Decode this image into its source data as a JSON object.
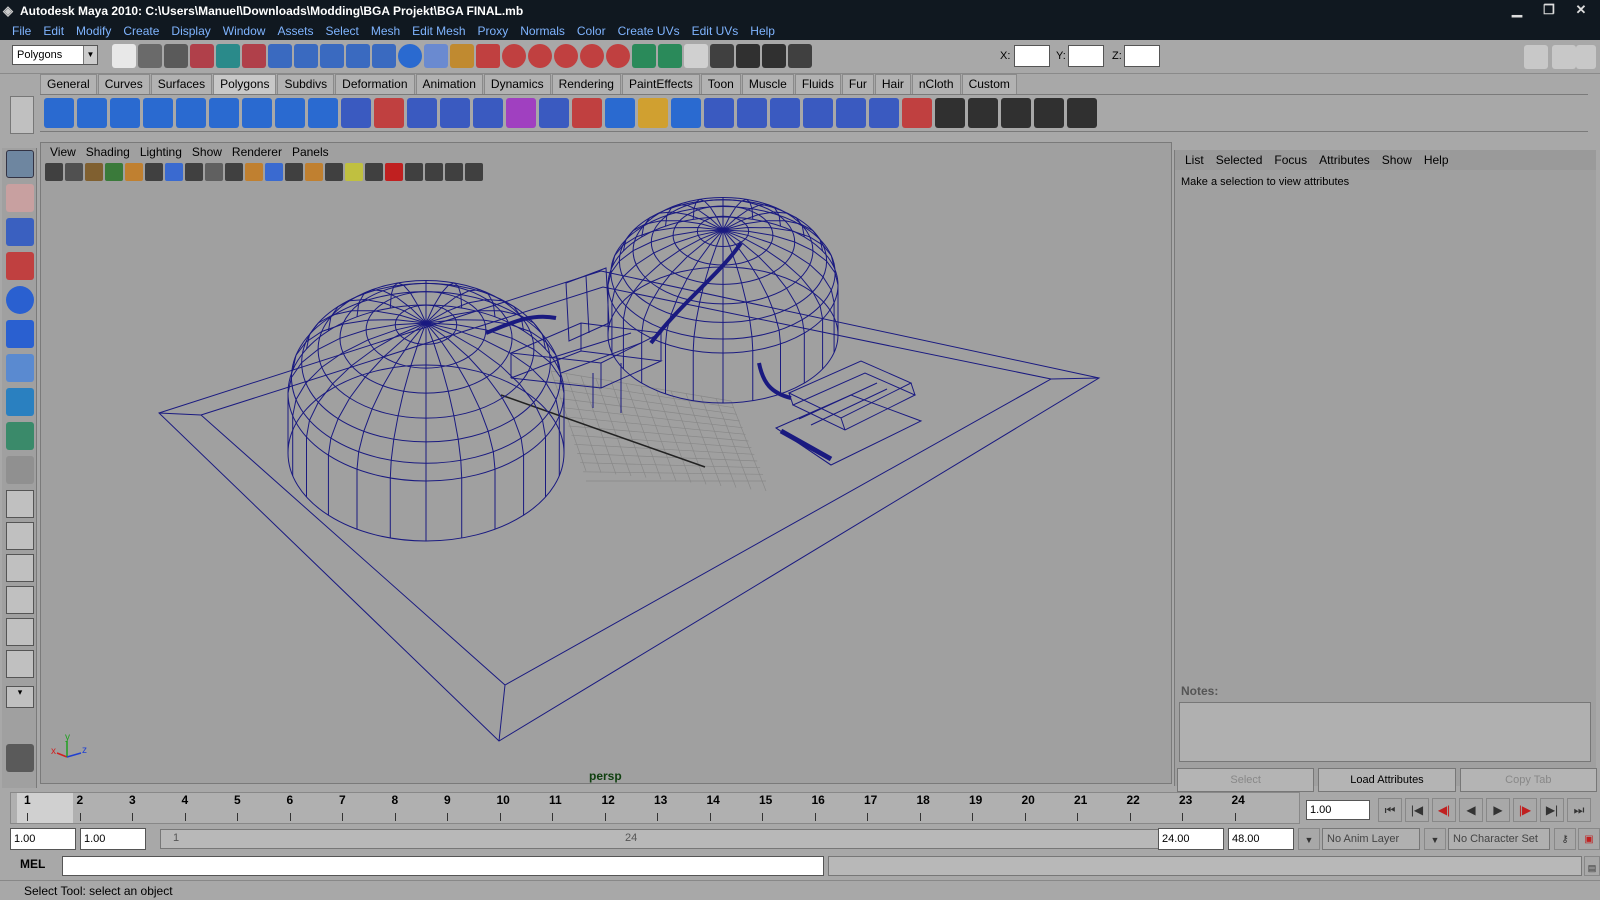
{
  "window": {
    "title": "Autodesk Maya 2010: C:\\Users\\Manuel\\Downloads\\Modding\\BGA Projekt\\BGA FINAL.mb"
  },
  "menubar": [
    "File",
    "Edit",
    "Modify",
    "Create",
    "Display",
    "Window",
    "Assets",
    "Select",
    "Mesh",
    "Edit Mesh",
    "Proxy",
    "Normals",
    "Color",
    "Create UVs",
    "Edit UVs",
    "Help"
  ],
  "status": {
    "mode": "Polygons",
    "x_label": "X:",
    "y_label": "Y:",
    "z_label": "Z:"
  },
  "shelf_tabs": [
    "General",
    "Curves",
    "Surfaces",
    "Polygons",
    "Subdivs",
    "Deformation",
    "Animation",
    "Dynamics",
    "Rendering",
    "PaintEffects",
    "Toon",
    "Muscle",
    "Fluids",
    "Fur",
    "Hair",
    "nCloth",
    "Custom"
  ],
  "shelf_active": "Polygons",
  "viewport": {
    "menu": [
      "View",
      "Shading",
      "Lighting",
      "Show",
      "Renderer",
      "Panels"
    ],
    "camera": "persp"
  },
  "attribute_editor": {
    "menu": [
      "List",
      "Selected",
      "Focus",
      "Attributes",
      "Show",
      "Help"
    ],
    "message": "Make a selection to view attributes",
    "notes_label": "Notes:",
    "buttons": [
      "Select",
      "Load Attributes",
      "Copy Tab"
    ]
  },
  "timeline": {
    "ticks": [
      "1",
      "2",
      "3",
      "4",
      "5",
      "6",
      "7",
      "8",
      "9",
      "10",
      "11",
      "12",
      "13",
      "14",
      "15",
      "16",
      "17",
      "18",
      "19",
      "20",
      "21",
      "22",
      "23",
      "24"
    ],
    "current_frame": "1.00"
  },
  "range": {
    "start": "1.00",
    "start2": "1.00",
    "slider_start": "1",
    "slider_end": "24",
    "end": "24.00",
    "end2": "48.00",
    "anim_layer": "No Anim Layer",
    "char_set": "No Character Set"
  },
  "command": {
    "label": "MEL"
  },
  "help_line": "Select Tool: select an object",
  "colors": {
    "wire": "#1a1a80",
    "title_bg": "#101820",
    "menu_text": "#7fb4ff",
    "ui_gray": "#a8a8a8"
  }
}
